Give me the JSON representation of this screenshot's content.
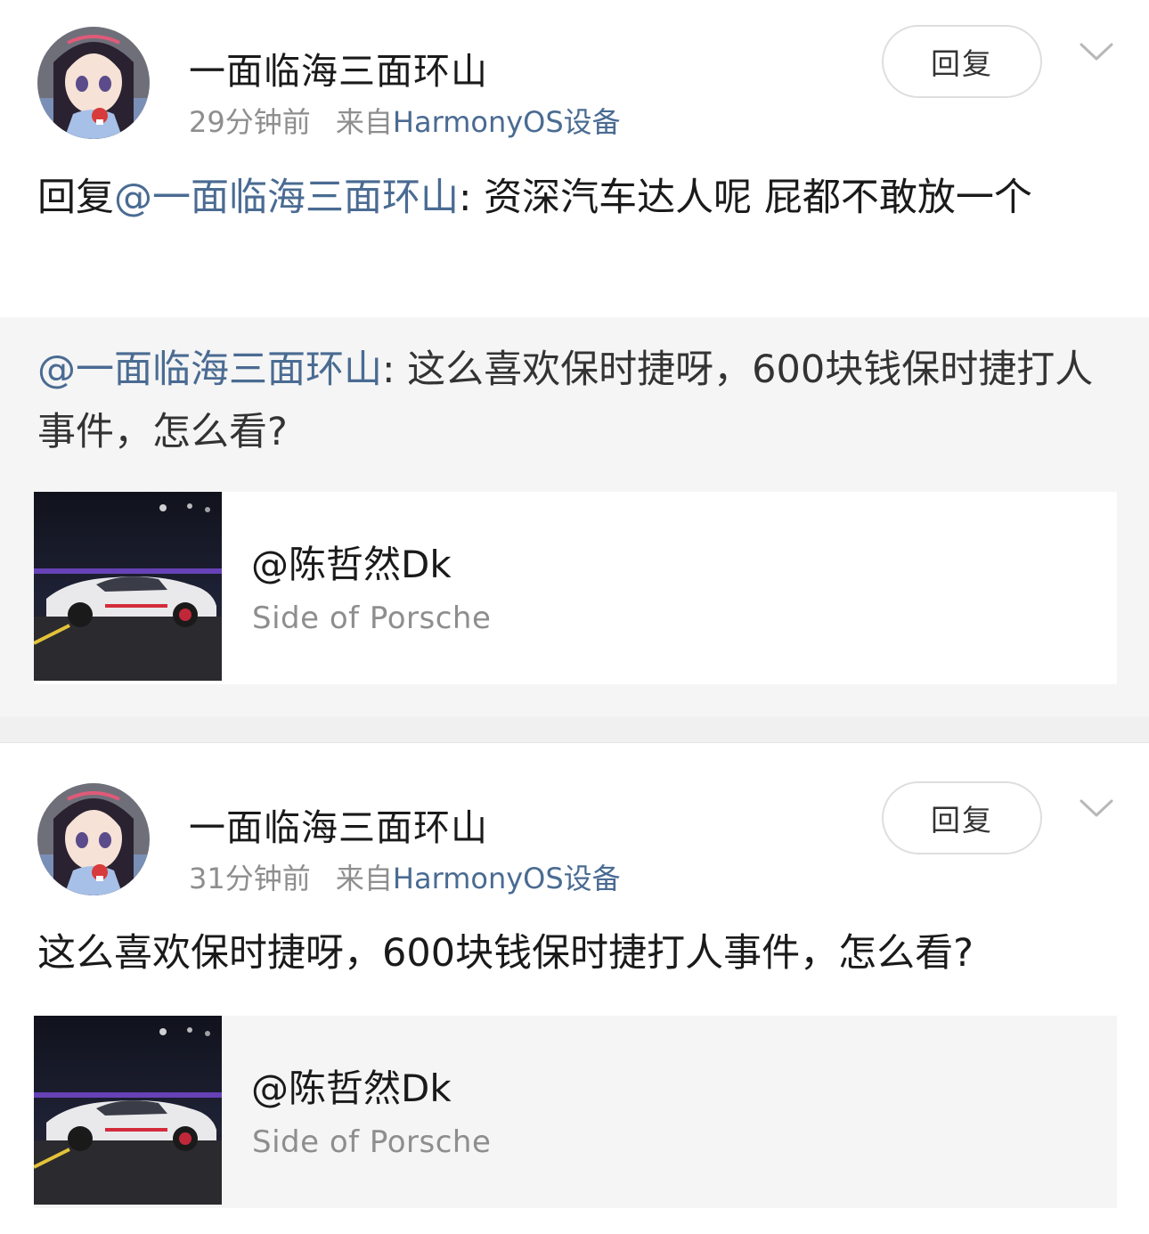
{
  "comments": [
    {
      "username": "一面临海三面环山",
      "time": "29分钟前",
      "source_prefix": "来自",
      "source": "HarmonyOS设备",
      "reply_button": "回复",
      "text_prefix": "回复",
      "text_mention": "@一面临海三面环山",
      "text_body": ": 资深汽车达人呢 屁都不敢放一个",
      "quoted": {
        "mention": "@一面临海三面环山",
        "body": ": 这么喜欢保时捷呀，600块钱保时捷打人事件，怎么看?"
      },
      "card": {
        "title": "@陈哲然Dk",
        "subtitle": "Side of Porsche"
      }
    },
    {
      "username": "一面临海三面环山",
      "time": "31分钟前",
      "source_prefix": "来自",
      "source": "HarmonyOS设备",
      "reply_button": "回复",
      "text_body": "这么喜欢保时捷呀，600块钱保时捷打人事件，怎么看?",
      "card": {
        "title": "@陈哲然Dk",
        "subtitle": "Side of Porsche"
      }
    }
  ],
  "colors": {
    "link": "#4a6b92",
    "meta": "#8e8e8e",
    "quote_bg": "#f5f5f5"
  }
}
